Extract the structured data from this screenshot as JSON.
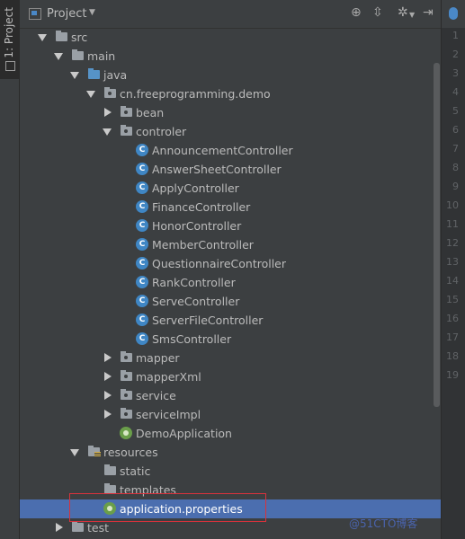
{
  "tool_window": {
    "label": "1: Project"
  },
  "header": {
    "title": "Project"
  },
  "gutter": {
    "line_numbers": [
      "1",
      "2",
      "3",
      "4",
      "5",
      "6",
      "7",
      "8",
      "9",
      "10",
      "11",
      "12",
      "13",
      "14",
      "15",
      "16",
      "17",
      "18",
      "19"
    ]
  },
  "tree": {
    "src": "src",
    "main": "main",
    "java": "java",
    "package": "cn.freeprogramming.demo",
    "bean": "bean",
    "controler": "controler",
    "controllers": [
      "AnnouncementController",
      "AnswerSheetController",
      "ApplyController",
      "FinanceController",
      "HonorController",
      "MemberController",
      "QuestionnaireController",
      "RankController",
      "ServeController",
      "ServerFileController",
      "SmsController"
    ],
    "mapper": "mapper",
    "mapperXml": "mapperXml",
    "service": "service",
    "serviceImpl": "serviceImpl",
    "demo_app": "DemoApplication",
    "resources": "resources",
    "static": "static",
    "templates": "templates",
    "application_properties": "application.properties",
    "test": "test"
  },
  "watermark": "@51CTO博客"
}
